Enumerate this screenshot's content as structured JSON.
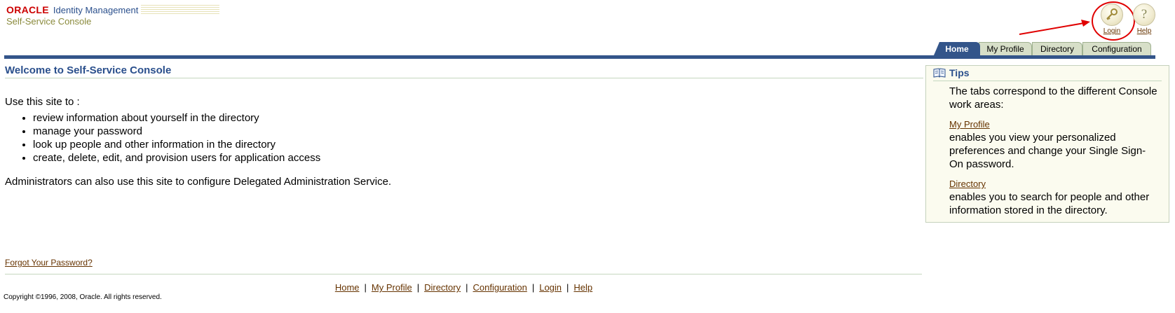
{
  "header": {
    "oracle": "ORACLE",
    "product": "Identity Management",
    "console": "Self-Service Console",
    "login_label": "Login",
    "help_label": "Help",
    "help_glyph": "?",
    "icons": {
      "login": "key-icon",
      "help": "question-icon"
    },
    "annotation_color": "#e00000"
  },
  "tabs": [
    {
      "label": "Home",
      "active": true
    },
    {
      "label": "My Profile",
      "active": false
    },
    {
      "label": "Directory",
      "active": false
    },
    {
      "label": "Configuration",
      "active": false
    }
  ],
  "main": {
    "title": "Welcome to Self-Service Console",
    "intro": "Use this site to :",
    "items": [
      "review information about yourself in the directory",
      "manage your password",
      "look up people and other information in the directory",
      "create, delete, edit, and provision users for application access"
    ],
    "admin_note": "Administrators can also use this site to configure Delegated Administration Service.",
    "forgot_link": "Forgot Your Password?"
  },
  "tips": {
    "title": "Tips",
    "icon": "book-icon",
    "intro": "The tabs correspond to the different Console work areas:",
    "profile_link": "My Profile",
    "profile_text": "enables you view your personalized preferences and change your Single Sign-On password.",
    "directory_link": "Directory",
    "directory_text": "enables you to search for people and other information stored in the directory."
  },
  "footer": {
    "links": [
      "Home",
      "My Profile",
      "Directory",
      "Configuration",
      "Login",
      "Help"
    ],
    "copyright": "Copyright ©1996, 2008, Oracle. All rights reserved."
  },
  "colors": {
    "brand_red": "#cc0000",
    "title_blue": "#2a4f8c",
    "tab_active": "#33558a",
    "tab_inactive": "#d7dfc8",
    "link_brown": "#663300"
  }
}
